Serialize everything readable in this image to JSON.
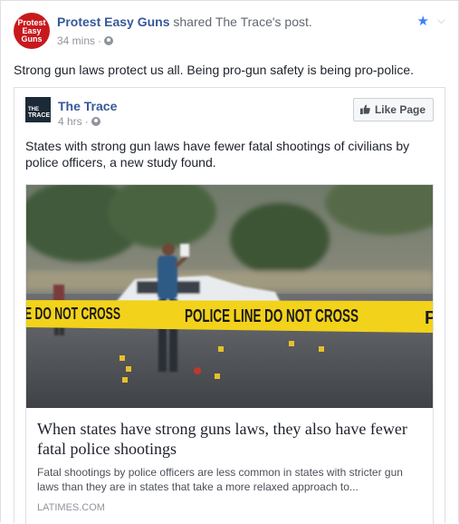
{
  "post": {
    "page_name": "Protest Easy Guns",
    "avatar_text": "Protest\nEasy\nGuns",
    "share_text": "shared The Trace's post.",
    "time": "34 mins",
    "status": "Strong gun laws protect us all. Being pro-gun safety is being pro-police."
  },
  "shared_post": {
    "page_name": "The Trace",
    "avatar_line1": "THE",
    "avatar_line2": "TRACE",
    "time": "4 hrs",
    "like_label": "Like Page",
    "text": "States with strong gun laws have fewer fatal shootings of civilians by police officers, a new study found."
  },
  "link": {
    "tape_left": "E DO NOT CROSS",
    "tape_main": "POLICE LINE DO NOT CROSS",
    "tape_right": "P",
    "title": "When states have strong guns laws, they also have fewer fatal police shootings",
    "description": "Fatal shootings by police officers are less common in states with stricter gun laws than they are in states that take a more relaxed approach to...",
    "domain": "LATIMES.COM"
  },
  "icons": {
    "avatar": "protest-easy-guns-logo",
    "globe": "globe-icon",
    "star": "star-icon",
    "chevron": "chevron-down-icon",
    "thumb": "thumbs-up-icon"
  },
  "colors": {
    "link_blue": "#365899",
    "star_blue": "#4080ff",
    "avatar_red": "#c8191d",
    "tape_yellow": "#f2d21b"
  }
}
